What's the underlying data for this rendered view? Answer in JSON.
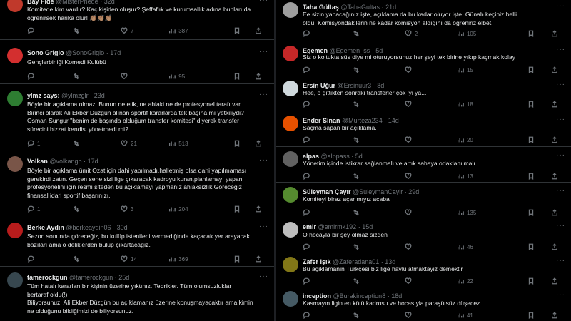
{
  "left": [
    {
      "name": "Bay Fide",
      "handle": "@MisterPhede",
      "time": "32d",
      "sep": "·",
      "lines": [
        "Komitede kim vardır? Kaç kişiden oluşur? Şeffaflık ve kurumsallık adına bunları da",
        "öğrenirsek harika olur! 👏🏽👏🏽👏🏽"
      ],
      "replies": "",
      "retweets": "",
      "likes": "7",
      "views": "387",
      "avatar_color": "#c0392b"
    },
    {
      "name": "Sono Grigio",
      "handle": "@SonoGrigio",
      "time": "17d",
      "sep": "·",
      "lines": [
        "Gençlerbirliği Komedi Kulübü"
      ],
      "replies": "",
      "retweets": "",
      "likes": "",
      "views": "95",
      "avatar_color": "#d32f2f"
    },
    {
      "name": "ylmz says:",
      "handle": "@ylmzglr",
      "time": "23d",
      "sep": "·",
      "lines": [
        "Böyle bir açıklama olmaz. Bunun ne etik, ne ahlaki ne de profesyonel tarafı var.",
        "Birinci olarak Ali Ekber Düzgün alınan sportif kararlarda tek başına mı yetkiliydi?",
        "Osman Sungur \"benim de başında olduğum transfer komitesi\" diyerek transfer",
        "sürecini bizzat kendisi yönetmedi mi?.."
      ],
      "replies": "1",
      "retweets": "",
      "likes": "21",
      "views": "513",
      "avatar_color": "#2e7d32"
    },
    {
      "name": "Volkan",
      "handle": "@volkangb",
      "time": "17d",
      "sep": "·",
      "lines": [
        "Böyle bir açıklama ümit Özat için dahi yapılmadı,halletmiş olsa dahi yapılmaması",
        "gerekirdi zatın. Geçen sene sizi lige çıkaracak kadroyu kuran,planlamayı yapan",
        "profesyonelini için resmi siteden bu açıklamayı yapmanız ahlaksızlık.Göreceğiz",
        "finansal idari sportif başarınızı."
      ],
      "replies": "1",
      "retweets": "",
      "likes": "3",
      "views": "204",
      "avatar_color": "#795548"
    },
    {
      "name": "Berke Aydın",
      "handle": "@berkeaydin06",
      "time": "30d",
      "sep": "·",
      "lines": [
        "Sezon sonunda göreceğiz, bu kulüp istenileni vermediğinde kaçacak yer arayacak",
        "bazıları ama o deliklerden bulup çıkartacağız."
      ],
      "replies": "",
      "retweets": "",
      "likes": "14",
      "views": "369",
      "avatar_color": "#b71c1c"
    },
    {
      "name": "tamerockgun",
      "handle": "@tamerockgun",
      "time": "25d",
      "sep": "·",
      "lines": [
        "Tüm hatalı kararları bir kişinin üzerine yıktınız. Tebrikler. Tüm olumsuzluklar",
        "bertaraf oldu(!)",
        "Biliyorsunuz, Ali Ekber Düzgün bu açıklamanız üzerine konuşmayacaktır ama kimin",
        "ne olduğunu bildiğimizi de biliyorsunuz."
      ],
      "replies": "",
      "retweets": "",
      "likes": "",
      "views": "",
      "avatar_color": "#37474f"
    }
  ],
  "right": [
    {
      "name": "Taha Gültaş",
      "handle": "@TahaGultas",
      "time": "21d",
      "sep": "·",
      "lines": [
        "Ee sizin yapacağınız işte, açıklama da bu kadar oluyor işte. Günah keçiniz belli",
        "oldu. Komisyondakilerin ne kadar komisyon aldığını da öğreniriz elbet."
      ],
      "replies": "",
      "retweets": "",
      "likes": "2",
      "views": "105",
      "avatar_color": "#9e9e9e"
    },
    {
      "name": "Egemen",
      "handle": "@Egemen_ss",
      "time": "5d",
      "sep": "·",
      "lines": [
        "Siz o koltukta süs diye mi oturuyorsunuz her şeyi tek birine yıkıp kaçmak kolay"
      ],
      "replies": "",
      "retweets": "",
      "likes": "",
      "views": "15",
      "avatar_color": "#c62828"
    },
    {
      "name": "Ersin Uğur",
      "handle": "@Ersinuur3",
      "time": "8d",
      "sep": "·",
      "lines": [
        "Hee, o gittikten sonraki transferler çok iyi ya..."
      ],
      "replies": "",
      "retweets": "",
      "likes": "",
      "views": "18",
      "avatar_color": "#cfd8dc"
    },
    {
      "name": "Ender Sinan",
      "handle": "@Murteza234",
      "time": "14d",
      "sep": "·",
      "lines": [
        "Saçma sapan bir açıklama."
      ],
      "replies": "",
      "retweets": "",
      "likes": "",
      "views": "20",
      "avatar_color": "#e65100"
    },
    {
      "name": "alpas",
      "handle": "@alppass",
      "time": "5d",
      "sep": "·",
      "lines": [
        "Yönetim içinde istikrar sağlanmalı ve artık sahaya odaklanılmalı"
      ],
      "replies": "",
      "retweets": "",
      "likes": "",
      "views": "13",
      "avatar_color": "#616161"
    },
    {
      "name": "Süleyman Çayır",
      "handle": "@SuleymanCayir",
      "time": "29d",
      "sep": "·",
      "lines": [
        "Komiteyi biraz açar mıyız acaba"
      ],
      "replies": "",
      "retweets": "",
      "likes": "",
      "views": "135",
      "avatar_color": "#558b2f"
    },
    {
      "name": "emir",
      "handle": "@emirmk192",
      "time": "15d",
      "sep": "·",
      "lines": [
        "O hocayla bir şey olmaz sizden"
      ],
      "replies": "",
      "retweets": "",
      "likes": "",
      "views": "46",
      "avatar_color": "#bdbdbd"
    },
    {
      "name": "Zafer Işık",
      "handle": "@Zaferadana01",
      "time": "13d",
      "sep": "·",
      "lines": [
        "Bu açıklamanin Türkçesi biz lige havlu atmaktayiz demektir"
      ],
      "replies": "",
      "retweets": "",
      "likes": "",
      "views": "22",
      "avatar_color": "#827717"
    },
    {
      "name": "inception",
      "handle": "@Burakinception8",
      "time": "18d",
      "sep": "·",
      "lines": [
        "Kasmayın ligin en kötü kadrosu ve hocasıyla paraşütsüz düşecez"
      ],
      "replies": "",
      "retweets": "",
      "likes": "",
      "views": "41",
      "avatar_color": "#455a64"
    }
  ]
}
